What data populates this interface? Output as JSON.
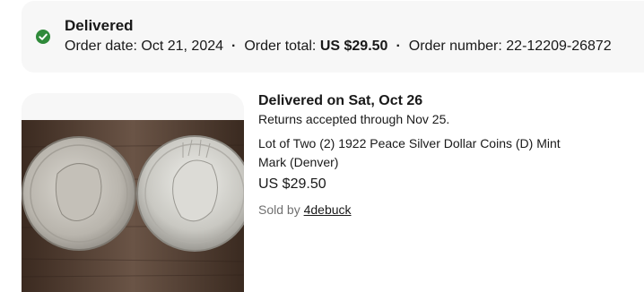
{
  "status": {
    "icon": "check-circle-icon",
    "icon_color": "#2f8a3a",
    "title": "Delivered"
  },
  "order": {
    "date_label": "Order date:",
    "date_value": "Oct 21, 2024",
    "total_label": "Order total:",
    "total_value": "US $29.50",
    "number_label": "Order number:",
    "number_value": "22-12209-26872",
    "separator": "·"
  },
  "item": {
    "delivered_on": "Delivered on Sat, Oct 26",
    "returns": "Returns accepted through Nov 25.",
    "title": "Lot of Two (2) 1922 Peace Silver Dollar Coins (D) Mint Mark (Denver)",
    "price": "US $29.50",
    "seller_label": "Sold by",
    "seller_name": "4debuck"
  }
}
